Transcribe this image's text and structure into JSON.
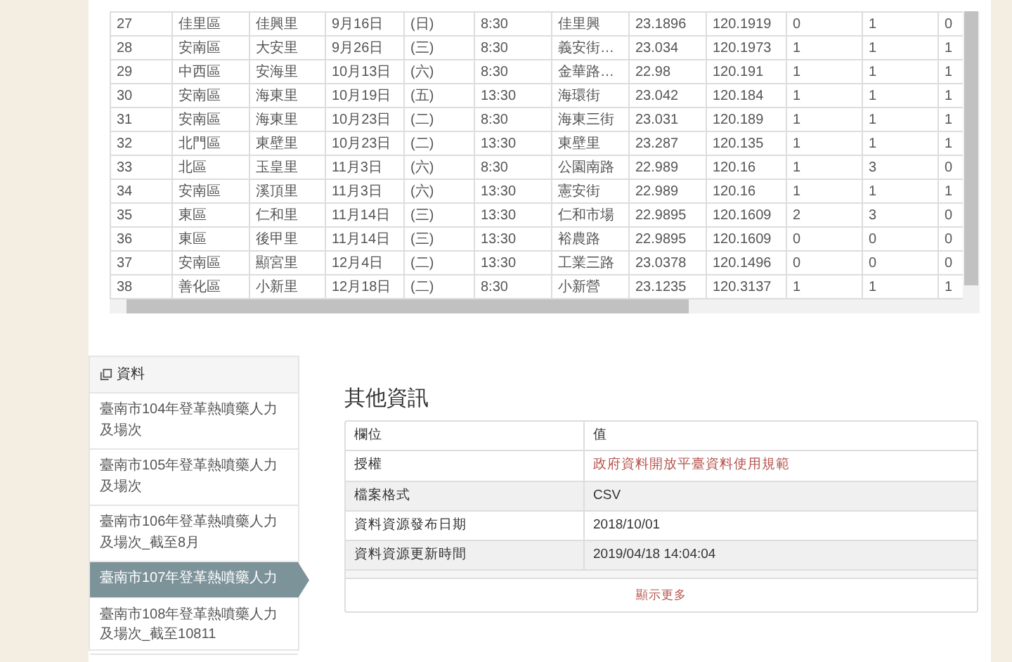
{
  "data_table": {
    "rows": [
      [
        "27",
        "佳里區",
        "佳興里",
        "9月16日",
        "(日)",
        "8:30",
        "佳里興",
        "23.1896",
        "120.1919",
        "0",
        "1",
        "0"
      ],
      [
        "28",
        "安南區",
        "大安里",
        "9月26日",
        "(三)",
        "8:30",
        "義安街…",
        "23.034",
        "120.1973",
        "1",
        "1",
        "1"
      ],
      [
        "29",
        "中西區",
        "安海里",
        "10月13日",
        "(六)",
        "8:30",
        "金華路…",
        "22.98",
        "120.191",
        "1",
        "1",
        "1"
      ],
      [
        "30",
        "安南區",
        "海東里",
        "10月19日",
        "(五)",
        "13:30",
        "海環街",
        "23.042",
        "120.184",
        "1",
        "1",
        "1"
      ],
      [
        "31",
        "安南區",
        "海東里",
        "10月23日",
        "(二)",
        "8:30",
        "海東三街",
        "23.031",
        "120.189",
        "1",
        "1",
        "1"
      ],
      [
        "32",
        "北門區",
        "東壁里",
        "10月23日",
        "(二)",
        "13:30",
        "東壁里",
        "23.287",
        "120.135",
        "1",
        "1",
        "1"
      ],
      [
        "33",
        "北區",
        "玉皇里",
        "11月3日",
        "(六)",
        "8:30",
        "公園南路",
        "22.989",
        "120.16",
        "1",
        "3",
        "0"
      ],
      [
        "34",
        "安南區",
        "溪頂里",
        "11月3日",
        "(六)",
        "13:30",
        "憲安街",
        "22.989",
        "120.16",
        "1",
        "1",
        "1"
      ],
      [
        "35",
        "東區",
        "仁和里",
        "11月14日",
        "(三)",
        "13:30",
        "仁和市場",
        "22.9895",
        "120.1609",
        "2",
        "3",
        "0"
      ],
      [
        "36",
        "東區",
        "後甲里",
        "11月14日",
        "(三)",
        "13:30",
        "裕農路",
        "22.9895",
        "120.1609",
        "0",
        "0",
        "0"
      ],
      [
        "37",
        "安南區",
        "顯宮里",
        "12月4日",
        "(二)",
        "13:30",
        "工業三路",
        "23.0378",
        "120.1496",
        "0",
        "0",
        "0"
      ],
      [
        "38",
        "善化區",
        "小新里",
        "12月18日",
        "(二)",
        "8:30",
        "小新營",
        "23.1235",
        "120.3137",
        "1",
        "1",
        "1"
      ]
    ]
  },
  "sidebar": {
    "title": "資料",
    "items": [
      {
        "label": "臺南市104年登革熱噴藥人力及場次",
        "selected": false
      },
      {
        "label": "臺南市105年登革熱噴藥人力及場次",
        "selected": false
      },
      {
        "label": "臺南市106年登革熱噴藥人力及場次_截至8月",
        "selected": false
      },
      {
        "label": "臺南市107年登革熱噴藥人力",
        "selected": true
      },
      {
        "label": "臺南市108年登革熱噴藥人力及場次_截至10811",
        "selected": false
      }
    ]
  },
  "info": {
    "title": "其他資訊",
    "columns": [
      "欄位",
      "值"
    ],
    "rows": [
      {
        "field": "授權",
        "value": "政府資料開放平臺資料使用規範",
        "kind": "link"
      },
      {
        "field": "檔案格式",
        "value": "CSV",
        "kind": "text"
      },
      {
        "field": "資料資源發布日期",
        "value": "2018/10/01",
        "kind": "text"
      },
      {
        "field": "資料資源更新時間",
        "value": "2019/04/18 14:04:04",
        "kind": "text"
      }
    ],
    "more": "顯示更多"
  }
}
